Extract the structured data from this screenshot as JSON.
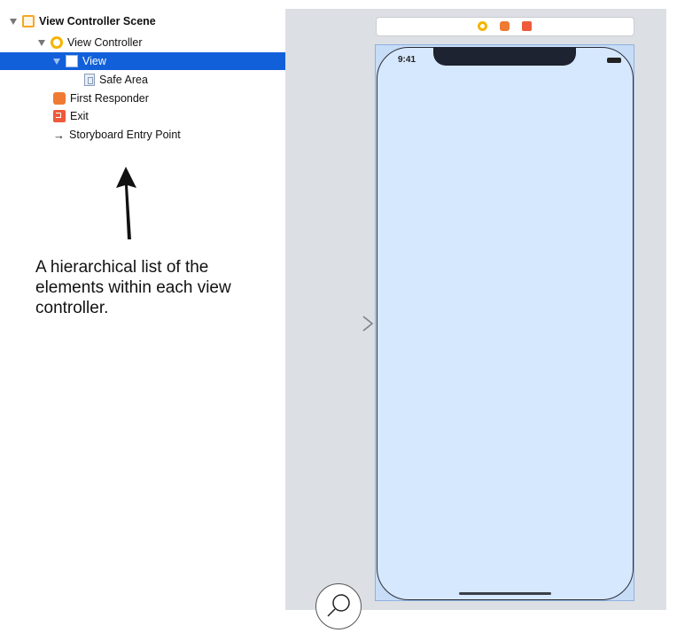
{
  "outline": {
    "items": [
      {
        "label": "View Controller Scene",
        "level": 0,
        "expanded": true,
        "icon": "scene-icon",
        "bold": true,
        "selected": false
      },
      {
        "label": "View Controller",
        "level": 1,
        "expanded": true,
        "icon": "view-controller-icon",
        "bold": false,
        "selected": false
      },
      {
        "label": "View",
        "level": 2,
        "expanded": true,
        "icon": "view-icon",
        "bold": false,
        "selected": true
      },
      {
        "label": "Safe Area",
        "level": 3,
        "expanded": false,
        "icon": "safe-area-icon",
        "bold": false,
        "selected": false
      },
      {
        "label": "First Responder",
        "level": 1,
        "expanded": false,
        "icon": "first-responder-icon",
        "bold": false,
        "selected": false
      },
      {
        "label": "Exit",
        "level": 1,
        "expanded": false,
        "icon": "exit-icon",
        "bold": false,
        "selected": false
      },
      {
        "label": "Storyboard Entry Point",
        "level": 1,
        "expanded": false,
        "icon": "entry-arrow-icon",
        "bold": false,
        "selected": false
      }
    ],
    "selection_color": "#1160d9"
  },
  "annotation": {
    "text": "A hierarchical list of the elements within each view controller."
  },
  "canvas": {
    "device": {
      "time": "9:41",
      "background_color": "#d6e8fd"
    },
    "scene_dock_icons": [
      "view-controller-icon",
      "first-responder-icon",
      "exit-icon"
    ]
  }
}
